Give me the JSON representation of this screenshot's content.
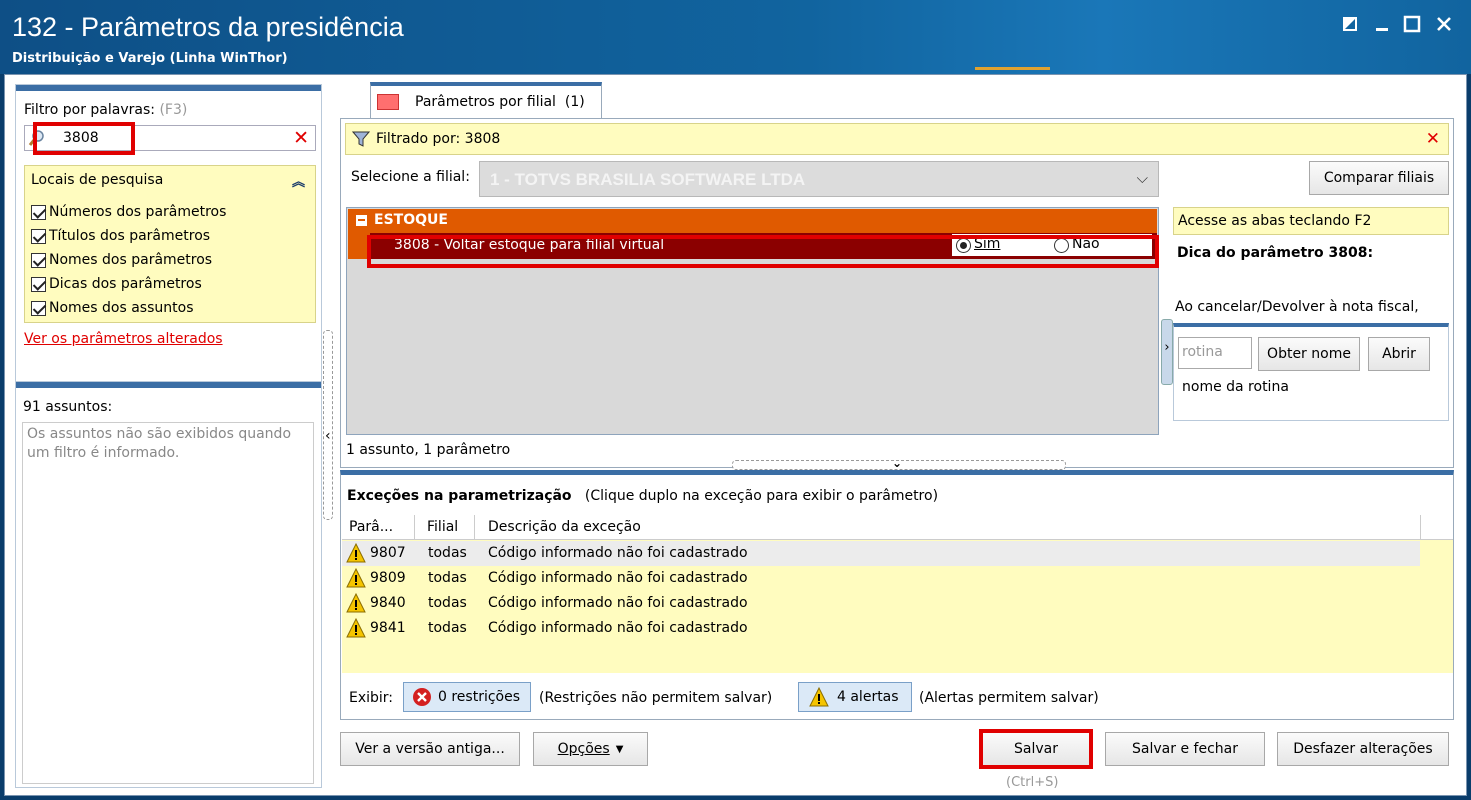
{
  "window": {
    "title": "132 - Parâmetros da presidência",
    "subtitle": "Distribuição e Varejo (Linha WinThor)"
  },
  "left": {
    "filter_label": "Filtro por palavras:",
    "filter_hint": "(F3)",
    "search_value": "3808",
    "locais_title": "Locais de pesquisa",
    "checkboxes": [
      "Números dos parâmetros",
      "Títulos dos parâmetros",
      "Nomes dos parâmetros",
      "Dicas dos parâmetros",
      "Nomes dos assuntos"
    ],
    "changed_link": "Ver os parâmetros alterados",
    "assuntos_label": "91 assuntos:",
    "assuntos_info": "Os assuntos não são exibidos quando um filtro é informado."
  },
  "main": {
    "tab_label": "Parâmetros por filial",
    "tab_count": "(1)",
    "filtered_by": "Filtrado por: 3808",
    "select_label": "Selecione a filial:",
    "filial_value": "1 - TOTVS BRASILIA SOFTWARE LTDA",
    "compare_button": "Comparar filiais",
    "group_title": "ESTOQUE",
    "param_text": "3808 - Voltar estoque para filial virtual",
    "radio_yes": "Sim",
    "radio_no": "Não",
    "radio_selected": "Sim",
    "count_text": "1 assunto, 1 parâmetro"
  },
  "side": {
    "access_tip": "Acesse as abas teclando F2",
    "dica_title": "Dica do parâmetro 3808:",
    "dica_body": "Ao cancelar/Devolver à nota fiscal,",
    "rotina_placeholder": "rotina",
    "get_name_button": "Obter nome",
    "open_button": "Abrir",
    "rotina_name_label": "nome da rotina"
  },
  "exceptions": {
    "title": "Exceções na parametrização",
    "subtitle": "(Clique duplo na exceção para exibir o parâmetro)",
    "columns": [
      "Parâ...",
      "Filial",
      "Descrição da exceção"
    ],
    "rows": [
      {
        "param": "9807",
        "filial": "todas",
        "desc": "Código informado não foi cadastrado"
      },
      {
        "param": "9809",
        "filial": "todas",
        "desc": "Código informado não foi cadastrado"
      },
      {
        "param": "9840",
        "filial": "todas",
        "desc": "Código informado não foi cadastrado"
      },
      {
        "param": "9841",
        "filial": "todas",
        "desc": "Código informado não foi cadastrado"
      }
    ],
    "show_label": "Exibir:",
    "restrictions_button": "0 restrições",
    "restrictions_note": "(Restrições não permitem salvar)",
    "alerts_button": "4 alertas",
    "alerts_note": "(Alertas permitem salvar)"
  },
  "footer": {
    "old_version_button": "Ver a versão antiga...",
    "options_button": "Opções",
    "save_button": "Salvar",
    "save_shortcut": "(Ctrl+S)",
    "save_close_button": "Salvar e fechar",
    "undo_button": "Desfazer alterações"
  },
  "colors": {
    "title_bar": "#11649f",
    "highlight": "#e00000",
    "group_orange": "#e05a00",
    "row_selected": "#8b0000",
    "tip_yellow": "#fffcbf"
  }
}
